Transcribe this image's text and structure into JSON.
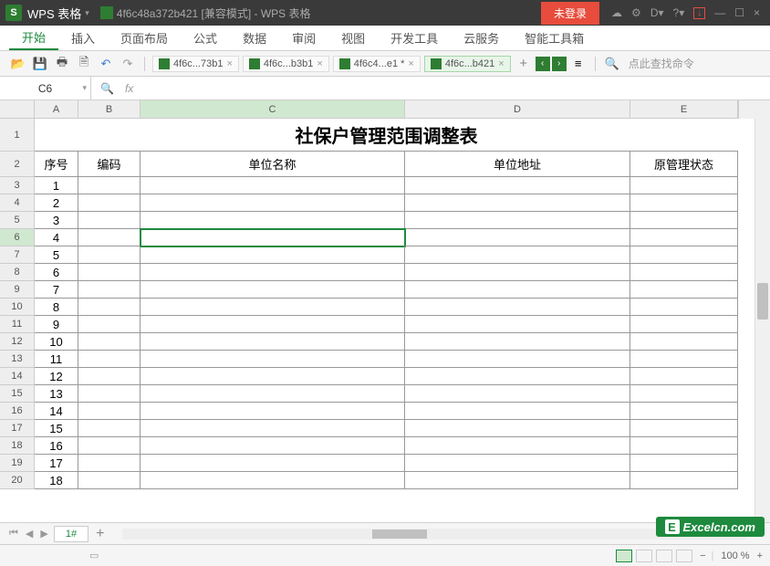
{
  "app": {
    "name": "WPS 表格",
    "title": "4f6c48a372b421 [兼容模式] - WPS 表格",
    "login": "未登录"
  },
  "menu": {
    "items": [
      "开始",
      "插入",
      "页面布局",
      "公式",
      "数据",
      "审阅",
      "视图",
      "开发工具",
      "云服务",
      "智能工具箱"
    ],
    "active_index": 0
  },
  "toolbar": {
    "file_tabs": [
      {
        "label": "4f6c...73b1",
        "active": false
      },
      {
        "label": "4f6c...b3b1",
        "active": false
      },
      {
        "label": "4f6c4...e1 *",
        "active": false
      },
      {
        "label": "4f6c...b421",
        "active": true
      }
    ],
    "search_placeholder": "点此查找命令"
  },
  "formula_bar": {
    "cell_ref": "C6",
    "fx_label": "fx",
    "formula": ""
  },
  "columns": [
    "A",
    "B",
    "C",
    "D",
    "E"
  ],
  "selected_column": "C",
  "selected_row": 6,
  "sheet": {
    "title": "社保户管理范围调整表",
    "headers": {
      "A": "序号",
      "B": "编码",
      "C": "单位名称",
      "D": "单位地址",
      "E": "原管理状态"
    },
    "rows": [
      {
        "num": 1
      },
      {
        "num": 2
      },
      {
        "num": 3
      },
      {
        "num": 4
      },
      {
        "num": 5
      },
      {
        "num": 6
      },
      {
        "num": 7
      },
      {
        "num": 8
      },
      {
        "num": 9
      },
      {
        "num": 10
      },
      {
        "num": 11
      },
      {
        "num": 12
      },
      {
        "num": 13
      },
      {
        "num": 14
      },
      {
        "num": 15
      },
      {
        "num": 16
      },
      {
        "num": 17
      },
      {
        "num": 18
      }
    ]
  },
  "sheet_tabs": {
    "active": "1#"
  },
  "status": {
    "zoom": "100 %",
    "watermark": "Excelcn.com"
  },
  "icons": {
    "open": "📂",
    "save": "💾",
    "print": "🖶",
    "preview": "🗎",
    "undo": "↶",
    "redo": "↷",
    "plus": "+",
    "left": "‹",
    "right": "›",
    "list": "≡",
    "search": "🔍",
    "minus": "−",
    "dropdown": "▾",
    "close": "×",
    "min": "—",
    "max": "☐",
    "cloud": "☁",
    "gear": "⚙",
    "help": "?",
    "down": "↓"
  }
}
